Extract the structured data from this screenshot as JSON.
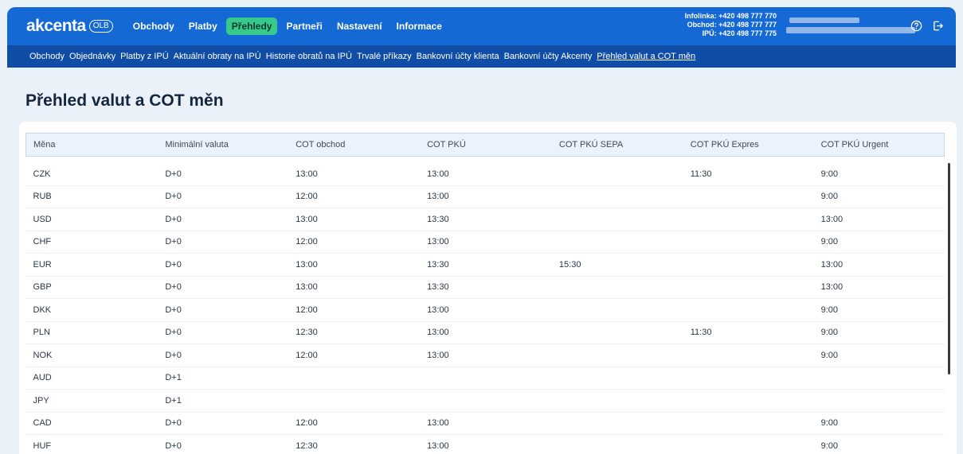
{
  "brand": {
    "name": "akcenta",
    "badge": "OLB"
  },
  "main_nav": [
    {
      "label": "Obchody",
      "active": false
    },
    {
      "label": "Platby",
      "active": false
    },
    {
      "label": "Přehledy",
      "active": true
    },
    {
      "label": "Partneři",
      "active": false
    },
    {
      "label": "Nastavení",
      "active": false
    },
    {
      "label": "Informace",
      "active": false
    }
  ],
  "contact": {
    "infolinka": "Infolinka: +420 498 777 770",
    "obchod": "Obchod: +420 498 777 777",
    "ipu": "IPÚ: +420 498 777 775"
  },
  "icons": {
    "help": "help-circle-icon",
    "logout": "logout-icon"
  },
  "sub_nav": [
    {
      "label": "Obchody",
      "current": false
    },
    {
      "label": "Objednávky",
      "current": false
    },
    {
      "label": "Platby z IPÚ",
      "current": false
    },
    {
      "label": "Aktuální obraty na IPÚ",
      "current": false
    },
    {
      "label": "Historie obratů na IPÚ",
      "current": false
    },
    {
      "label": "Trvalé příkazy",
      "current": false
    },
    {
      "label": "Bankovní účty klienta",
      "current": false
    },
    {
      "label": "Bankovní účty Akcenty",
      "current": false
    },
    {
      "label": "Přehled valut a COT měn",
      "current": true
    }
  ],
  "page": {
    "title": "Přehled valut a COT měn"
  },
  "table": {
    "columns": [
      "Měna",
      "Minimální valuta",
      "COT obchod",
      "COT PKÚ",
      "COT PKÚ SEPA",
      "COT PKÚ Expres",
      "COT PKÚ Urgent"
    ],
    "rows": [
      [
        "CZK",
        "D+0",
        "13:00",
        "13:00",
        "",
        "11:30",
        "9:00"
      ],
      [
        "RUB",
        "D+0",
        "12:00",
        "13:00",
        "",
        "",
        "9:00"
      ],
      [
        "USD",
        "D+0",
        "13:00",
        "13:30",
        "",
        "",
        "13:00"
      ],
      [
        "CHF",
        "D+0",
        "12:00",
        "13:00",
        "",
        "",
        "9:00"
      ],
      [
        "EUR",
        "D+0",
        "13:00",
        "13:30",
        "15:30",
        "",
        "13:00"
      ],
      [
        "GBP",
        "D+0",
        "13:00",
        "13:30",
        "",
        "",
        "13:00"
      ],
      [
        "DKK",
        "D+0",
        "12:00",
        "13:00",
        "",
        "",
        "9:00"
      ],
      [
        "PLN",
        "D+0",
        "12:30",
        "13:00",
        "",
        "11:30",
        "9:00"
      ],
      [
        "NOK",
        "D+0",
        "12:00",
        "13:00",
        "",
        "",
        "9:00"
      ],
      [
        "AUD",
        "D+1",
        "",
        "",
        "",
        "",
        ""
      ],
      [
        "JPY",
        "D+1",
        "",
        "",
        "",
        "",
        ""
      ],
      [
        "CAD",
        "D+0",
        "12:00",
        "13:00",
        "",
        "",
        "9:00"
      ],
      [
        "HUF",
        "D+0",
        "12:30",
        "13:00",
        "",
        "",
        "9:00"
      ]
    ]
  },
  "colors": {
    "topbar": "#1569d4",
    "subnav": "#0f4da6",
    "active_nav": "#36c98b",
    "page_bg": "#eaf1f9"
  }
}
